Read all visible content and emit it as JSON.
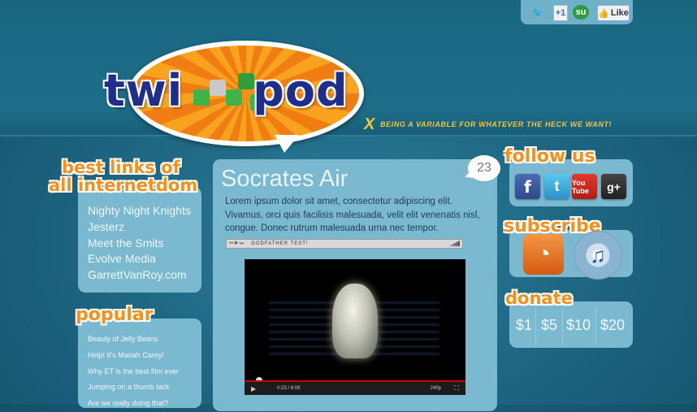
{
  "share_bar": {
    "twitter_icon": "twitter-bird-icon",
    "gplus_label": "+1",
    "stumble_label": "su",
    "fb_like_label": "Like"
  },
  "logo": {
    "text_left": "twi",
    "text_right": "pod",
    "tagline_x": "X",
    "tagline": "BEING A VARIABLE FOR WHATEVER THE HECK WE WANT!"
  },
  "best_links": {
    "title_line1": "best links of",
    "title_line2": "all internetdom",
    "items": [
      "Nighty Night Knights",
      "Jesterz",
      "Meet the Smits",
      "Evolve Media",
      "GarrettVanRoy.com"
    ]
  },
  "popular": {
    "title": "popular",
    "items": [
      "Beauty of Jelly Beans",
      "Help! It's Mariah Carey!",
      "Why ET is the best film ever",
      "Jumping on a thumb tack",
      "Are we really doing that?"
    ]
  },
  "post": {
    "title": "Socrates Air",
    "comment_count": "23",
    "body": "Lorem ipsum dolor sit amet, consectetur adipiscing elit. Vivamus, orci quis facilisis malesuada, velit elit venenatis nisl, congue. Donec rutrum malesuada urna nec tempor.",
    "audio_label": "GODFATHER TEST!",
    "video": {
      "time": "0:23 / 6:08",
      "quality": "240p"
    }
  },
  "follow": {
    "title": "follow us",
    "fb": "f",
    "tw": "t",
    "yt_label": "You Tube",
    "gp": "g+"
  },
  "subscribe": {
    "title": "subscribe"
  },
  "donate": {
    "title": "donate",
    "amounts": [
      "$1",
      "$5",
      "$10",
      "$20"
    ]
  }
}
